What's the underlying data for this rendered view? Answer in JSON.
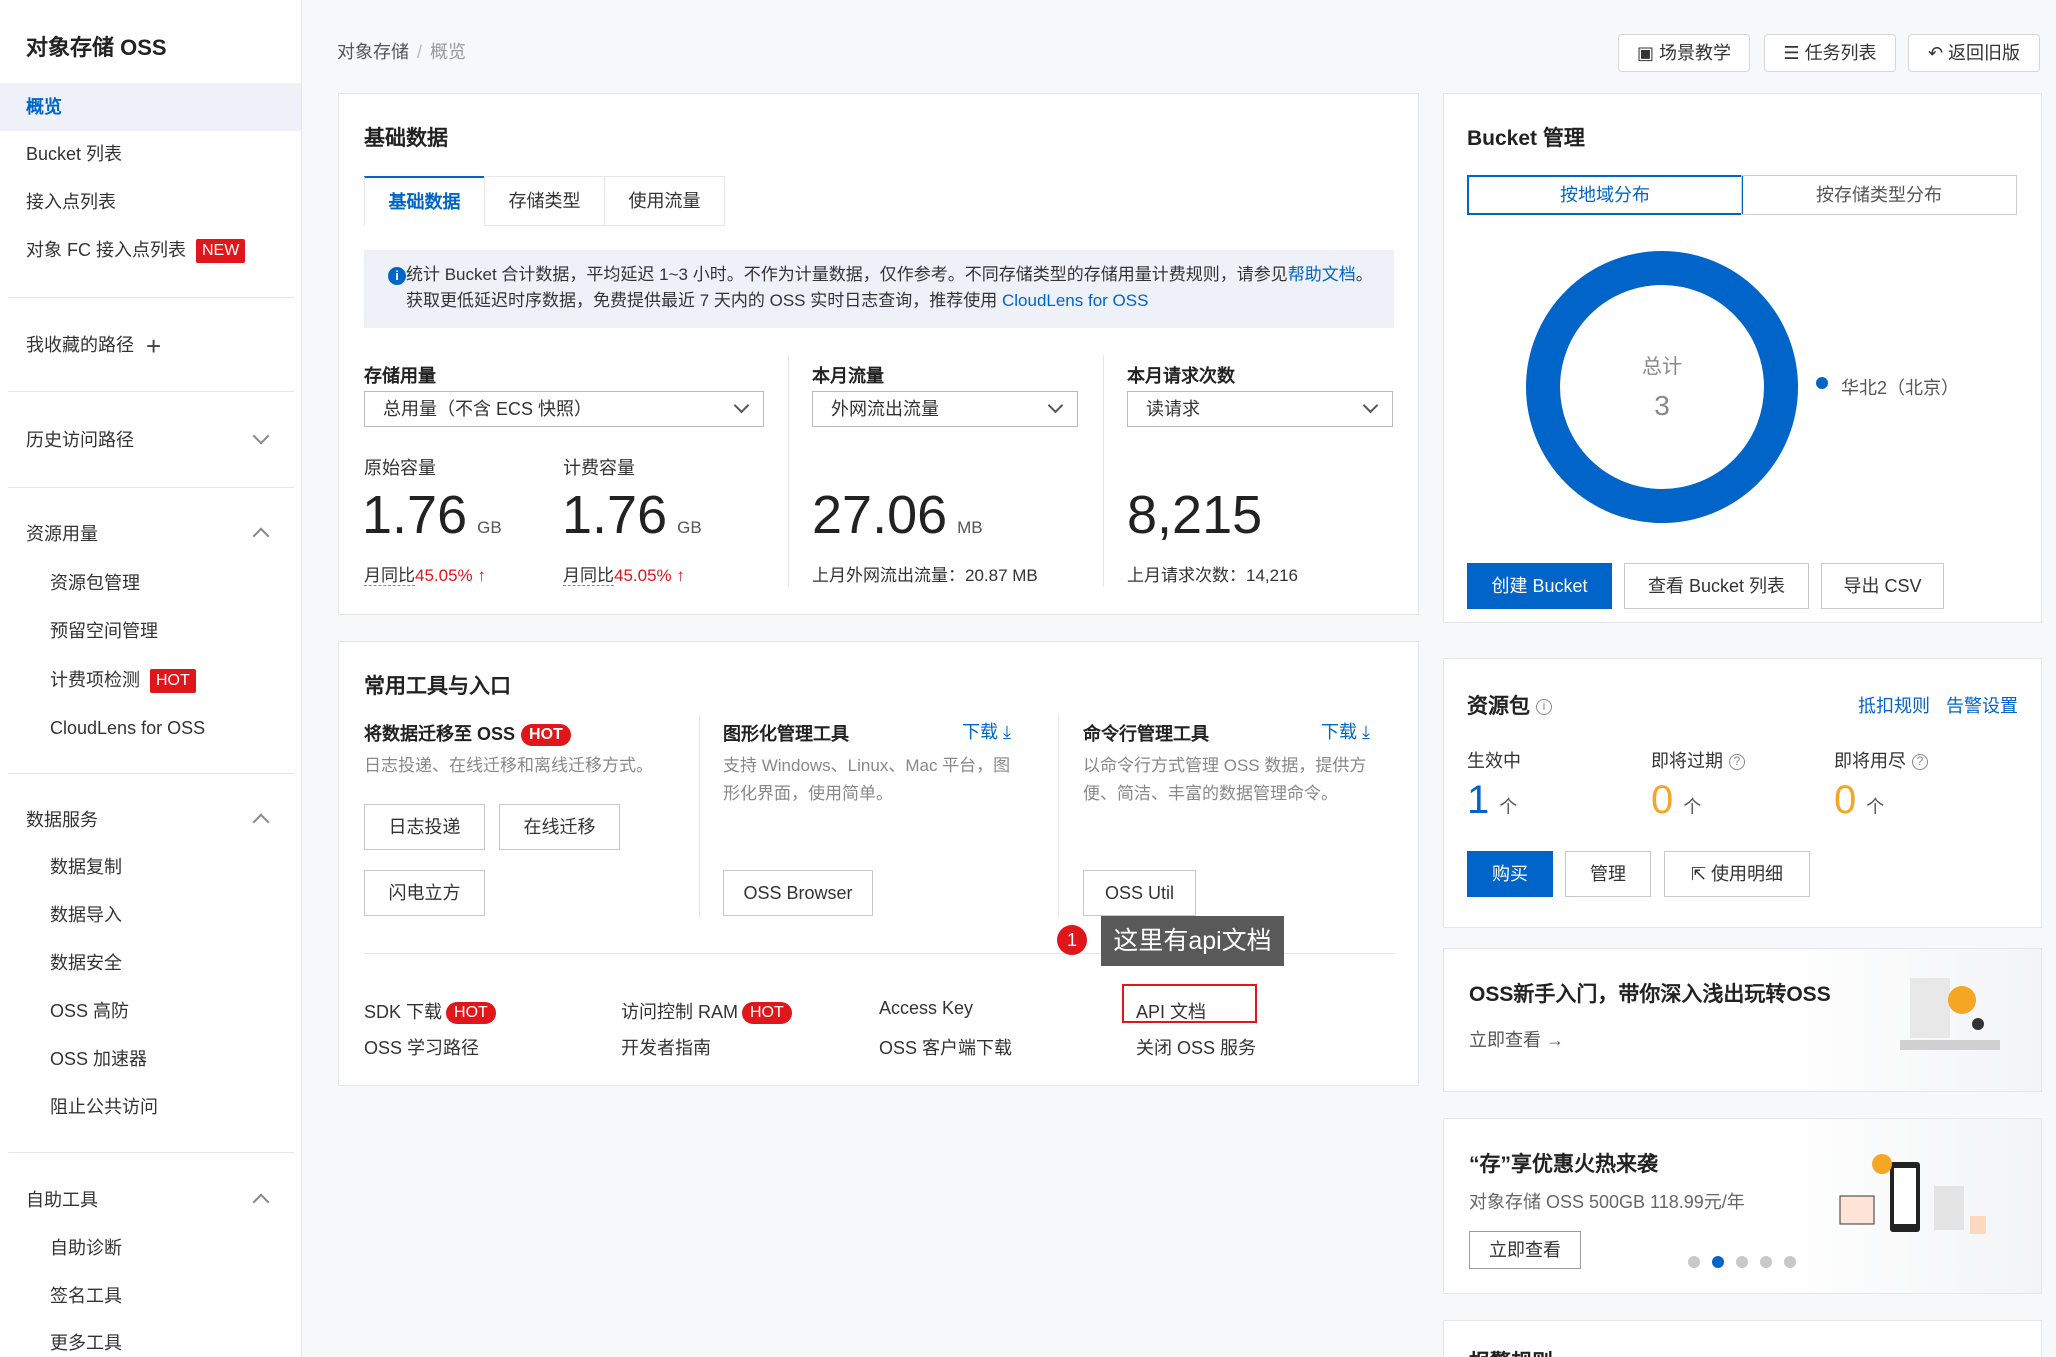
{
  "sidebar": {
    "title": "对象存储 OSS",
    "items": {
      "overview": "概览",
      "bucket_list": "Bucket 列表",
      "access_points": "接入点列表",
      "fc_access_points": "对象 FC 接入点列表",
      "fc_badge": "NEW",
      "favorites": "我收藏的路径",
      "history": "历史访问路径",
      "resource_usage": "资源用量",
      "resource_pkg": "资源包管理",
      "reserved_space": "预留空间管理",
      "billing_check": "计费项检测",
      "billing_badge": "HOT",
      "cloudlens": "CloudLens for OSS",
      "data_services": "数据服务",
      "data_copy": "数据复制",
      "data_import": "数据导入",
      "data_security": "数据安全",
      "oss_defense": "OSS 高防",
      "oss_accel": "OSS 加速器",
      "block_public": "阻止公共访问",
      "self_tools": "自助工具",
      "self_diag": "自助诊断",
      "sign_tool": "签名工具",
      "more_tools": "更多工具"
    }
  },
  "header": {
    "crumb_root": "对象存储",
    "crumb_sep": "/",
    "crumb_current": "概览",
    "btn_scene": "场景教学",
    "btn_tasks": "任务列表",
    "btn_old": "返回旧版"
  },
  "basic": {
    "title": "基础数据",
    "tabs": [
      "基础数据",
      "存储类型",
      "使用流量"
    ],
    "info_pre": "统计 Bucket 合计数据，平均延迟 1~3 小时。不作为计量数据，仅作参考。不同存储类型的存储用量计费规则，请参见",
    "info_link1": "帮助文档",
    "info_mid": "。 获取更低延迟时序数据，免费提供最近 7 天内的 OSS 实时日志查询，推荐使用 ",
    "info_link2": "CloudLens for OSS",
    "storage_label": "存储用量",
    "storage_select": "总用量（不含 ECS 快照）",
    "raw_label": "原始容量",
    "raw_value": "1.76",
    "raw_unit": "GB",
    "raw_cmp_label": "月同比",
    "raw_cmp_pct": "45.05%",
    "bill_label": "计费容量",
    "bill_value": "1.76",
    "bill_unit": "GB",
    "bill_cmp_label": "月同比",
    "bill_cmp_pct": "45.05%",
    "traffic_label": "本月流量",
    "traffic_select": "外网流出流量",
    "traffic_value": "27.06",
    "traffic_unit": "MB",
    "traffic_last": "上月外网流出流量：20.87 MB",
    "req_label": "本月请求次数",
    "req_select": "读请求",
    "req_value": "8,215",
    "req_last": "上月请求次数：14,216"
  },
  "tools": {
    "title": "常用工具与入口",
    "migrate_title": "将数据迁移至 OSS",
    "migrate_badge": "HOT",
    "migrate_desc": "日志投递、在线迁移和离线迁移方式。",
    "btn_log": "日志投递",
    "btn_online": "在线迁移",
    "btn_flash": "闪电立方",
    "gui_title": "图形化管理工具",
    "gui_download": "下载",
    "gui_desc1": "支持 Windows、Linux、Mac 平台，图",
    "gui_desc2": "形化界面，使用简单。",
    "btn_browser": "OSS Browser",
    "cli_title": "命令行管理工具",
    "cli_download": "下载",
    "cli_desc1": "以命令行方式管理 OSS 数据，提供方",
    "cli_desc2": "便、简洁、丰富的数据管理命令。",
    "btn_util": "OSS Util",
    "links": {
      "sdk": "SDK 下载",
      "sdk_badge": "HOT",
      "learn": "OSS 学习路径",
      "ram": "访问控制 RAM",
      "ram_badge": "HOT",
      "dev_guide": "开发者指南",
      "access_key": "Access Key",
      "client_dl": "OSS 客户端下载",
      "api_doc": "API 文档",
      "close_oss": "关闭 OSS 服务"
    },
    "callout_num": "1",
    "callout_text": "这里有api文档"
  },
  "bucket": {
    "title": "Bucket 管理",
    "seg1": "按地域分布",
    "seg2": "按存储类型分布",
    "donut_label": "总计",
    "donut_value": "3",
    "legend": "华北2（北京）",
    "btn_create": "创建 Bucket",
    "btn_view": "查看 Bucket 列表",
    "btn_export": "导出 CSV",
    "accent": "#0064c8"
  },
  "resource": {
    "title": "资源包",
    "rule_link": "抵扣规则",
    "alarm_link": "告警设置",
    "active_label": "生效中",
    "active_value": "1",
    "unit": "个",
    "expiring_label": "即将过期",
    "expiring_value": "0",
    "running_out_label": "即将用尽",
    "running_out_value": "0",
    "btn_buy": "购买",
    "btn_manage": "管理",
    "btn_detail": "使用明细"
  },
  "promo1": {
    "title": "OSS新手入门，带你深入浅出玩转OSS",
    "link": "立即查看"
  },
  "promo2": {
    "title": "“存”享优惠火热来袭",
    "desc": "对象存储 OSS 500GB 118.99元/年",
    "btn": "立即查看"
  },
  "bottom_card_title": "报警规则"
}
